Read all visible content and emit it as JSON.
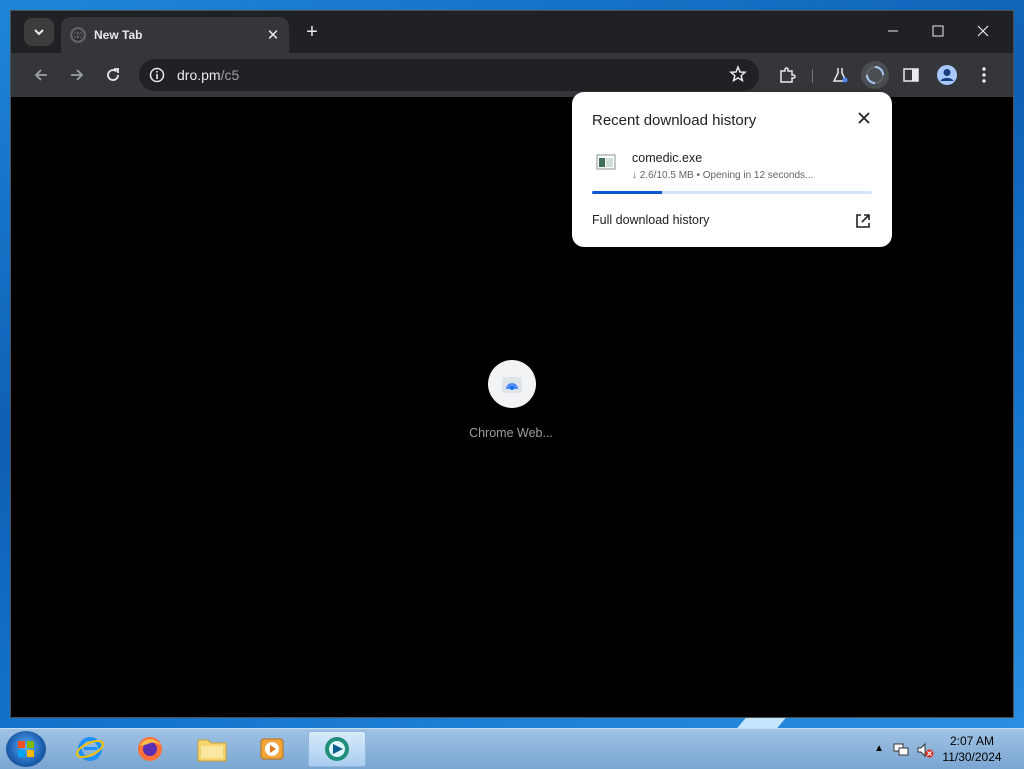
{
  "browser": {
    "tab": {
      "title": "New Tab",
      "favicon": "globe-icon"
    },
    "window_controls": [
      "minimize",
      "maximize",
      "close"
    ],
    "address": {
      "host": "dro.pm",
      "path": "/c5"
    }
  },
  "content": {
    "tile_label": "Chrome Web...",
    "background": "#000000"
  },
  "download_bubble": {
    "title": "Recent download history",
    "file": {
      "name": "comedic.exe",
      "status": "↓ 2.6/10.5 MB • Opening in 12 seconds...",
      "progress": 0.25
    },
    "full_history_label": "Full download history"
  },
  "taskbar": {
    "apps": [
      "internet-explorer",
      "firefox",
      "file-explorer",
      "media-player",
      "active-app"
    ],
    "clock": {
      "time": "2:07 AM",
      "date": "11/30/2024"
    }
  },
  "colors": {
    "accent": "#0b57d0",
    "tab_bg": "#35363a",
    "frame_bg": "#202124"
  }
}
